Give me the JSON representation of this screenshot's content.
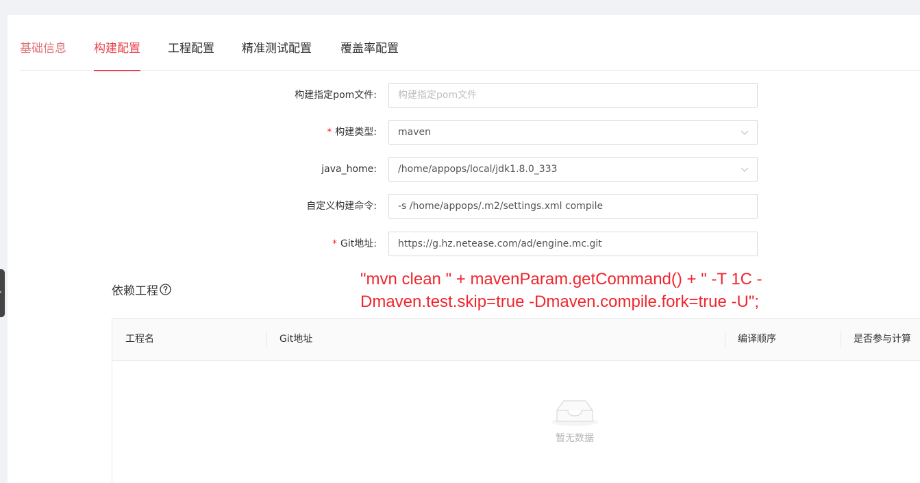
{
  "tabs": [
    {
      "label": "基础信息",
      "state": "faded"
    },
    {
      "label": "构建配置",
      "state": "active"
    },
    {
      "label": "工程配置",
      "state": "normal"
    },
    {
      "label": "精准测试配置",
      "state": "normal"
    },
    {
      "label": "覆盖率配置",
      "state": "normal"
    }
  ],
  "form": {
    "pom_file": {
      "label": "构建指定pom文件",
      "placeholder": "构建指定pom文件",
      "value": ""
    },
    "build_type": {
      "label": "构建类型",
      "required_mark": "*",
      "value": "maven"
    },
    "java_home": {
      "label": "java_home",
      "value": "/home/appops/local/jdk1.8.0_333"
    },
    "custom_cmd": {
      "label": "自定义构建命令",
      "value": "-s /home/appops/.m2/settings.xml compile"
    },
    "git_url": {
      "label": "Git地址",
      "required_mark": "*",
      "value": "https://g.hz.netease.com/ad/engine.mc.git"
    },
    "colon": ":"
  },
  "deps": {
    "title": "依赖工程",
    "help_icon": "question-circle-icon"
  },
  "annotation": {
    "line1": "\"mvn clean \" + mavenParam.getCommand() + \" -T 1C -",
    "line2": "Dmaven.test.skip=true -Dmaven.compile.fork=true -U\";"
  },
  "table": {
    "columns": [
      "工程名",
      "Git地址",
      "编译顺序",
      "是否参与计算"
    ],
    "empty_text": "暂无数据"
  },
  "colors": {
    "accent": "#e8414b",
    "annotation": "#f0262e"
  }
}
